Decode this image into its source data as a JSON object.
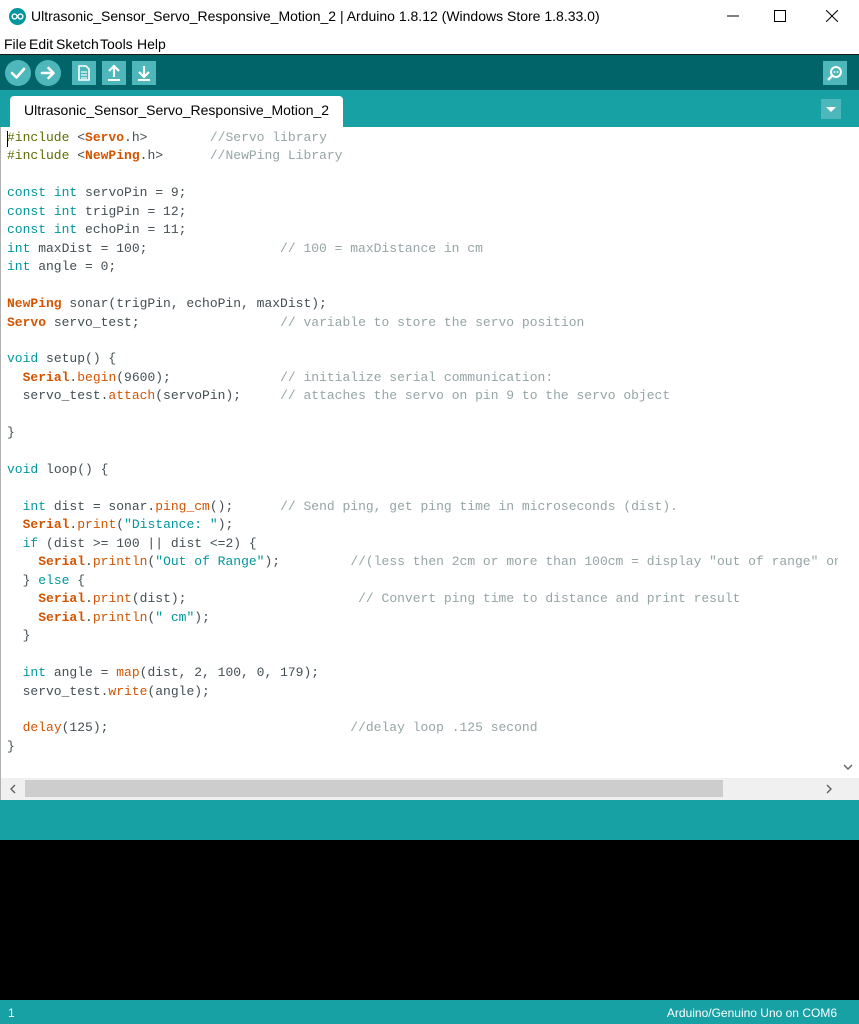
{
  "window": {
    "title": "Ultrasonic_Sensor_Servo_Responsive_Motion_2 | Arduino 1.8.12 (Windows Store 1.8.33.0)"
  },
  "menu": [
    "File",
    "Edit",
    "Sketch",
    "Tools",
    "Help"
  ],
  "toolbar": {
    "buttons": [
      "verify-icon",
      "upload-icon",
      "new-icon",
      "open-icon",
      "save-icon",
      "serial-monitor-icon"
    ]
  },
  "tabs": [
    {
      "label": "Ultrasonic_Sensor_Servo_Responsive_Motion_2",
      "active": true
    }
  ],
  "editor": {
    "lines": [
      "#include <Servo.h>        //Servo library",
      "#include <NewPing.h>      //NewPing Library",
      "",
      "const int servoPin = 9;",
      "const int trigPin = 12;",
      "const int echoPin = 11;",
      "int maxDist = 100;                 // 100 = maxDistance in cm",
      "int angle = 0;",
      "",
      "NewPing sonar(trigPin, echoPin, maxDist);",
      "Servo servo_test;                  // variable to store the servo position",
      "",
      "void setup() {",
      "  Serial.begin(9600);              // initialize serial communication:",
      "  servo_test.attach(servoPin);     // attaches the servo on pin 9 to the servo object",
      "",
      "}",
      "",
      "void loop() {",
      "",
      "  int dist = sonar.ping_cm();      // Send ping, get ping time in microseconds (dist).",
      "  Serial.print(\"Distance: \");",
      "  if (dist >= 100 || dist <=2) {",
      "    Serial.println(\"Out of Range\");         //(less then 2cm or more than 100cm = display \"out of range\" on",
      "  } else {",
      "    Serial.print(dist);                      // Convert ping time to distance and print result",
      "    Serial.println(\" cm\");",
      "  }",
      "",
      "  int angle = map(dist, 2, 100, 0, 179);",
      "  servo_test.write(angle);",
      "",
      "  delay(125);                               //delay loop .125 second",
      "}"
    ]
  },
  "status": {
    "line": "1",
    "board": "Arduino/Genuino Uno on COM6"
  },
  "colors": {
    "toolbar": "#006468",
    "tabstrip": "#17a1a5",
    "button": "#4db7bb",
    "keyword": "#00979c",
    "function": "#d35400",
    "comment": "#95a5a6",
    "console": "#000000"
  }
}
